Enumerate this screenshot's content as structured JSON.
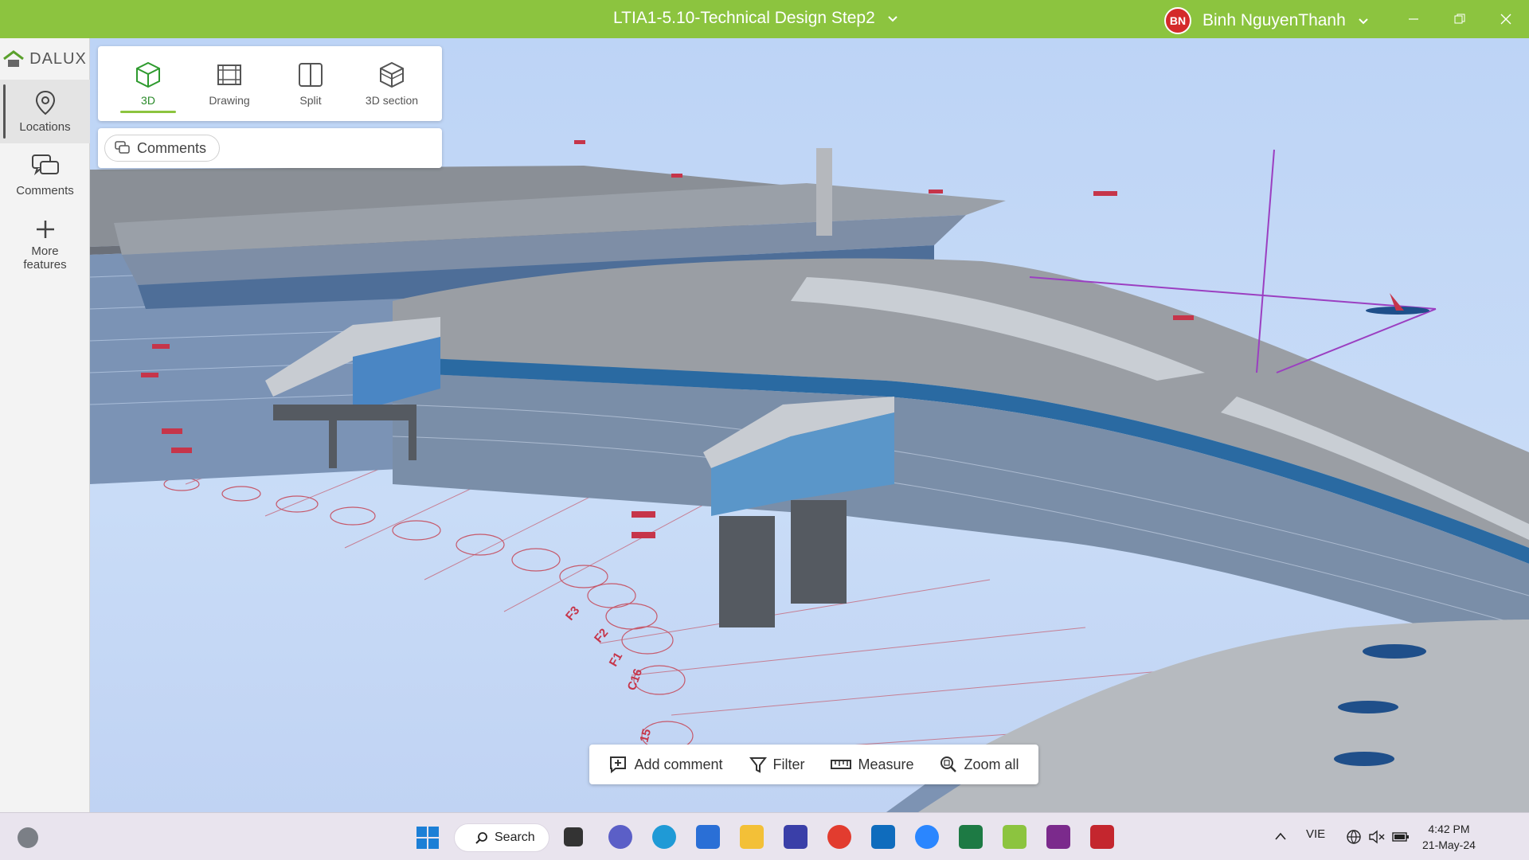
{
  "titlebar": {
    "document_title": "LTIA1-5.10-Technical Design Step2",
    "user_initials": "BN",
    "user_name": "Binh NguyenThanh",
    "color": "#8cc43f"
  },
  "sidebar": {
    "logo_text": "DALUX",
    "items": [
      {
        "label": "Locations",
        "icon": "location-pin-icon",
        "active": true
      },
      {
        "label": "Comments",
        "icon": "comments-icon"
      },
      {
        "label": "More features",
        "icon": "plus-icon"
      }
    ]
  },
  "view_modes": [
    {
      "label": "3D",
      "icon": "cube-icon",
      "active": true
    },
    {
      "label": "Drawing",
      "icon": "drawing-icon"
    },
    {
      "label": "Split",
      "icon": "split-icon"
    },
    {
      "label": "3D section",
      "icon": "section-cube-icon"
    }
  ],
  "comments_chip": "Comments",
  "toolbar": {
    "add_comment": "Add comment",
    "filter": "Filter",
    "measure": "Measure",
    "zoom_all": "Zoom all"
  },
  "model": {
    "gate_labels": [
      "F1",
      "F2",
      "F3",
      "C16",
      "15"
    ]
  },
  "taskbar": {
    "search_label": "Search",
    "language": "VIE",
    "time": "4:42 PM",
    "date": "21-May-24"
  }
}
